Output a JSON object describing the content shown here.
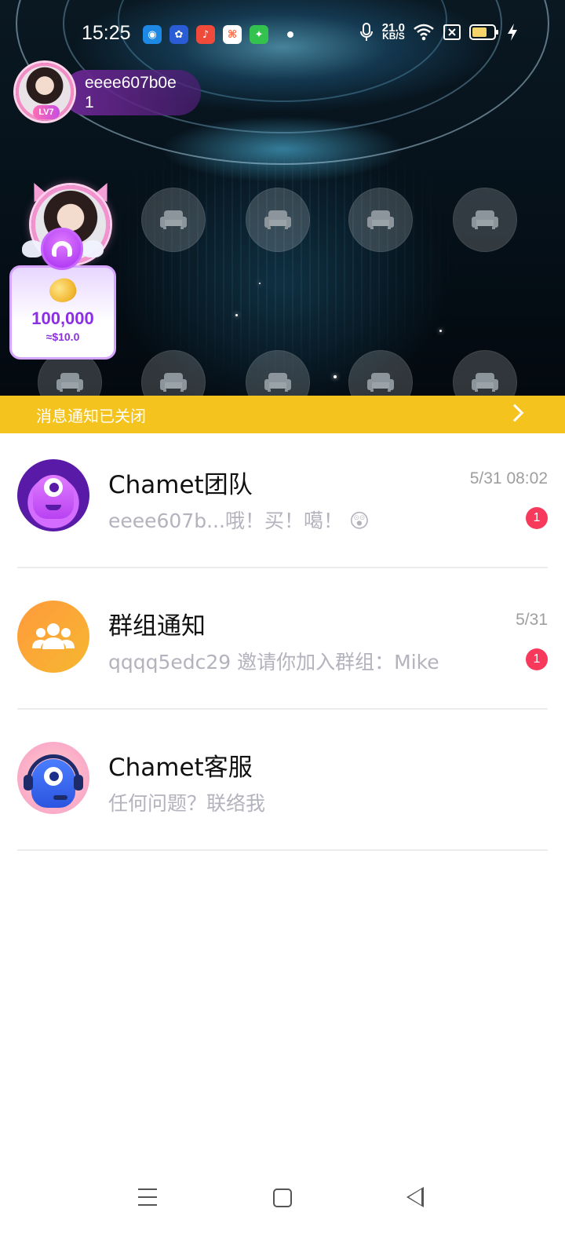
{
  "status_bar": {
    "time": "15:25",
    "net_speed_value": "21.0",
    "net_speed_unit": "KB/S",
    "icons": [
      "app-icon",
      "baidu-icon",
      "music-icon",
      "game-icon",
      "android-icon",
      "mic-icon",
      "wifi-icon",
      "sim-icon",
      "battery-icon",
      "charging-icon"
    ]
  },
  "room": {
    "host": {
      "name": "eeee607b0e",
      "count": "1",
      "level": "LV7"
    },
    "gift": {
      "amount": "100,000",
      "usd": "≈$10.0"
    },
    "seats_icon": "sofa-icon"
  },
  "notice": {
    "text": "消息通知已关闭",
    "color": "#f5c31e"
  },
  "conversations": [
    {
      "title": "Chamet团队",
      "preview": "eeee607b...哦！买！噶！ 😲",
      "time": "5/31 08:02",
      "badge": "1"
    },
    {
      "title": "群组通知",
      "preview": "qqqq5edc29 邀请你加入群组：Mike",
      "time": "5/31",
      "badge": "1"
    },
    {
      "title": "Chamet客服",
      "preview": "任何问题？联络我"
    }
  ],
  "colors": {
    "badge": "#f73a5c",
    "coin_text": "#8b2ee6"
  }
}
